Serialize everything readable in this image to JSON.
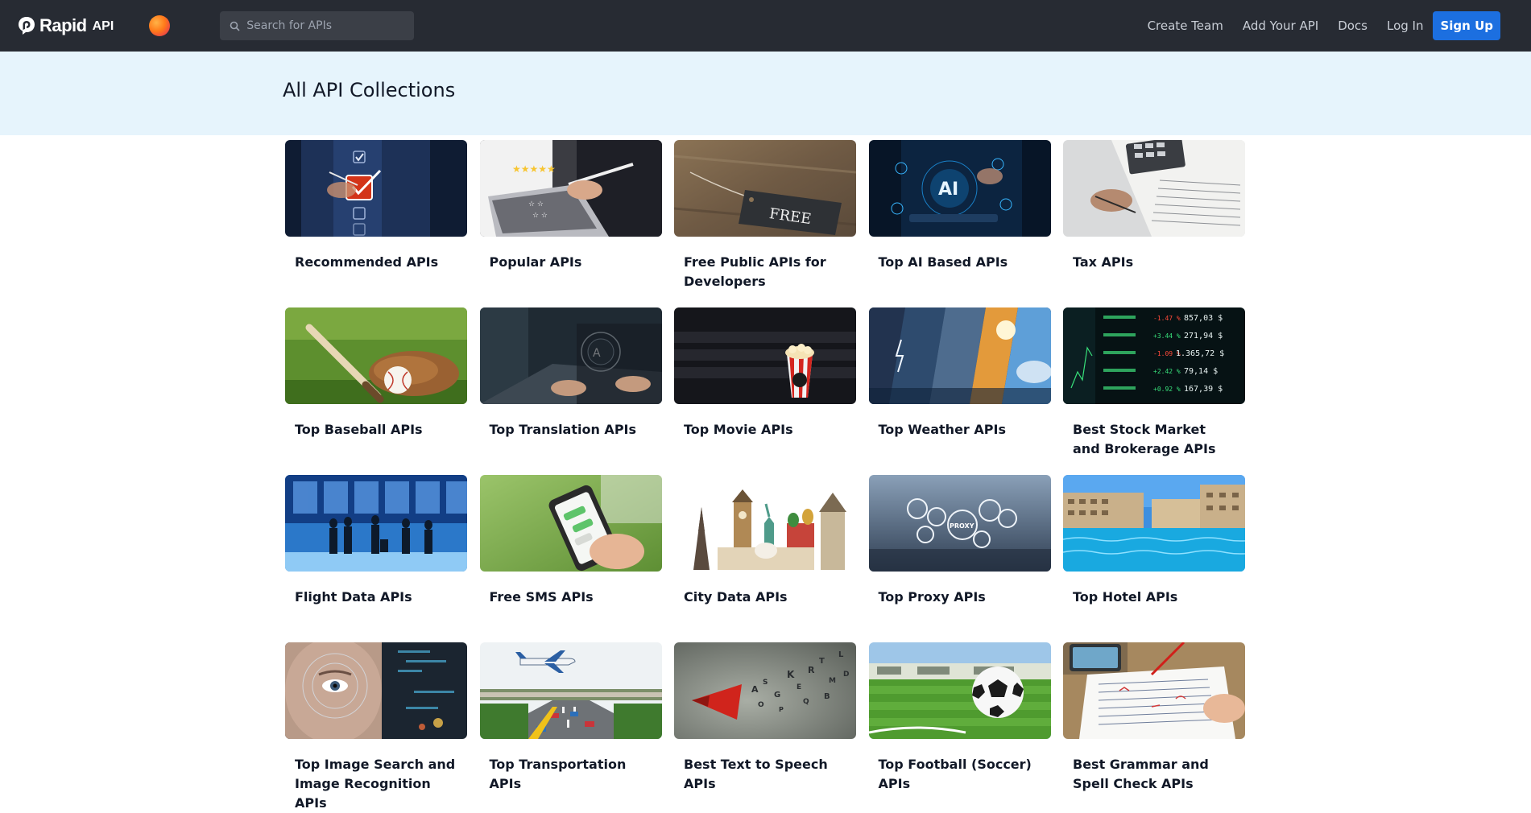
{
  "header": {
    "logo_word": "Rapid",
    "logo_sub": "API",
    "search_placeholder": "Search for APIs",
    "nav": [
      "Create Team",
      "Add Your API",
      "Docs",
      "Log In"
    ],
    "signup_label": "Sign Up"
  },
  "page": {
    "title": "All API Collections"
  },
  "collections": [
    {
      "title": "Recommended APIs",
      "icon": "checklist-image"
    },
    {
      "title": "Popular APIs",
      "icon": "laptop-rating-image"
    },
    {
      "title": "Free Public APIs for Developers",
      "icon": "free-tag-image",
      "tag_text": "FREE"
    },
    {
      "title": "Top AI Based APIs",
      "icon": "ai-chip-image",
      "tag_text": "AI"
    },
    {
      "title": "Tax APIs",
      "icon": "calculator-image"
    },
    {
      "title": "Top Baseball APIs",
      "icon": "baseball-image"
    },
    {
      "title": "Top Translation APIs",
      "icon": "translation-image"
    },
    {
      "title": "Top Movie APIs",
      "icon": "cinema-popcorn-image"
    },
    {
      "title": "Top Weather APIs",
      "icon": "weather-panels-image"
    },
    {
      "title": "Best Stock Market and Brokerage APIs",
      "icon": "stock-ticker-image",
      "ticker_values": [
        "857,03 $",
        "271,94 $",
        "1.365,72 $",
        "79,14 $",
        "167,39 $"
      ],
      "ticker_pct": [
        "-1.47 %",
        "+3.44 %",
        "-1.09 %",
        "+2.42 %",
        "+0.92 %"
      ]
    },
    {
      "title": "Flight Data APIs",
      "icon": "airport-travelers-image"
    },
    {
      "title": "Free SMS APIs",
      "icon": "smartphone-sms-image"
    },
    {
      "title": "City Data APIs",
      "icon": "world-landmarks-image"
    },
    {
      "title": "Top Proxy APIs",
      "icon": "proxy-gears-image",
      "tag_text": "PROXY"
    },
    {
      "title": "Top Hotel APIs",
      "icon": "hotel-pool-image"
    },
    {
      "title": "Top Image Search and Image Recognition APIs",
      "icon": "face-scan-image"
    },
    {
      "title": "Top Transportation APIs",
      "icon": "highway-plane-image"
    },
    {
      "title": "Best Text to Speech APIs",
      "icon": "megaphone-letters-image"
    },
    {
      "title": "Top Football (Soccer) APIs",
      "icon": "soccer-ball-image"
    },
    {
      "title": "Best Grammar and Spell Check APIs",
      "icon": "paper-correction-image"
    }
  ]
}
